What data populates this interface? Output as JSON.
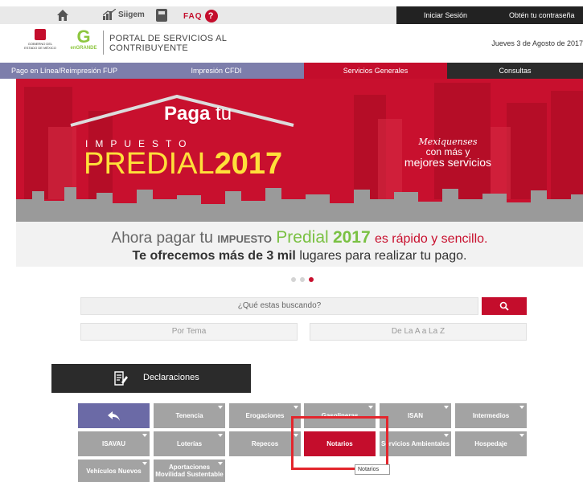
{
  "topbar": {
    "siigem_label": "Siigem",
    "faq_label": "FAQ",
    "faq_mark": "?",
    "login_label": "Iniciar Sesión",
    "password_label": "Obtén tu contraseña"
  },
  "header": {
    "state_logo_text": "GOBIERNO DEL ESTADO DE MÉXICO",
    "g_logo_text": "enGRANDE",
    "portal_title_line1": "PORTAL DE SERVICIOS AL",
    "portal_title_line2": "CONTRIBUYENTE",
    "date": "Jueves 3 de Agosto de 2017"
  },
  "nav": {
    "items": [
      {
        "label": "Pago en Línea/Reimpresión FUP",
        "color": "#7d7eab"
      },
      {
        "label": "Impresión CFDI",
        "color": "#7d7eab"
      },
      {
        "label": "Servicios Generales",
        "color": "#c40d2c"
      },
      {
        "label": "Consultas",
        "color": "#2b2b2b"
      }
    ]
  },
  "banner": {
    "paga": "Paga",
    "tu": "tu",
    "impuesto": "IMPUESTO",
    "predial": "PREDIAL",
    "year": "2017",
    "slogan1": "Mexiquenses",
    "slogan2": "con más y",
    "slogan3": "mejores servicios",
    "tagline_a": "Ahora pagar",
    "tagline_tu": "tu",
    "tagline_impuesto": "IMPUESTO",
    "tagline_predial": "Predial",
    "tagline_year": "2017",
    "tagline_end": "es rápido y sencillo.",
    "tagline2_bold": "Te ofrecemos más de 3 mil",
    "tagline2_rest": "lugares para realizar tu pago."
  },
  "search": {
    "placeholder": "¿Qué estas buscando?",
    "by_topic": "Por Tema",
    "a_to_z": "De La A a La Z"
  },
  "declaraciones": {
    "label": "Declaraciones"
  },
  "tiles": {
    "tenencia": "Tenencia",
    "erogaciones": "Erogaciones",
    "gasolineras": "Gasolineras",
    "isan": "ISAN",
    "intermedios": "Intermedios",
    "isavau": "ISAVAU",
    "loterias": "Loterías",
    "repecos": "Repecos",
    "notarios": "Notarios",
    "ambientales": "Servicios Ambientales",
    "hospedaje": "Hospedaje",
    "vehiculos": "Vehículos Nuevos",
    "aportaciones_1": "Aportaciones",
    "aportaciones_2": "Movilidad Sustentable",
    "tooltip": "Notarios"
  },
  "colors": {
    "brand_red": "#c40d2c",
    "nav_purple": "#7d7eab",
    "tile_gray": "#a3a3a3",
    "back_tile": "#6b6aa6"
  }
}
